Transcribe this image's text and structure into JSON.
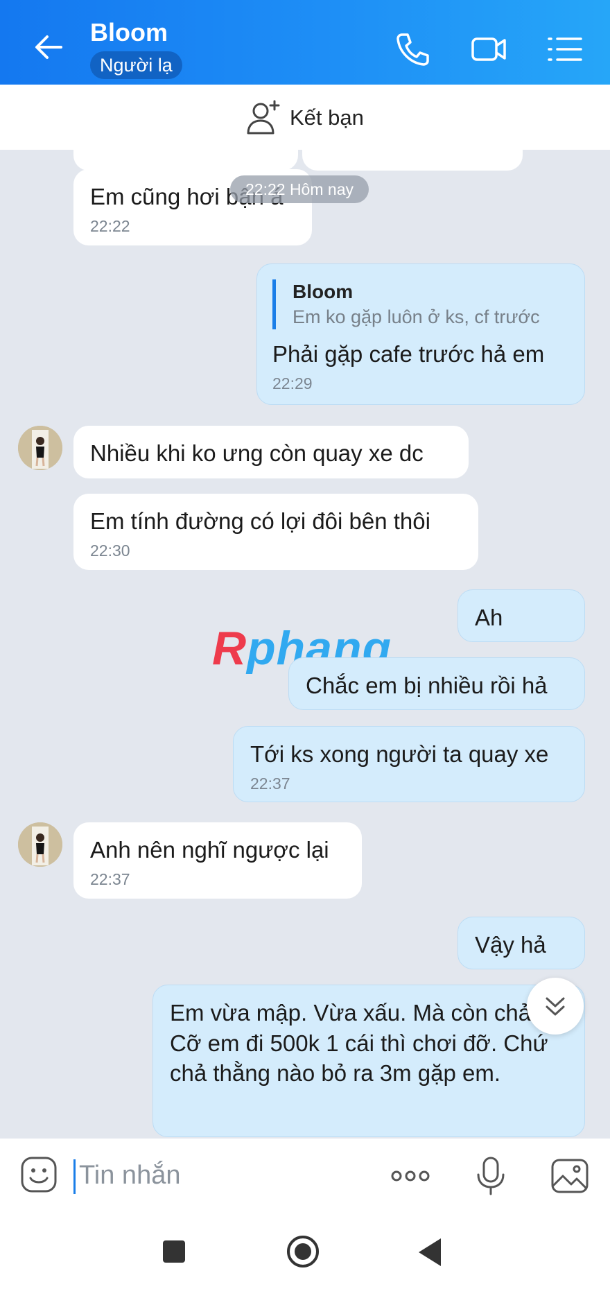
{
  "header": {
    "title": "Bloom",
    "subtitle": "Người lạ",
    "icons": [
      "back-arrow-icon",
      "phone-icon",
      "video-call-icon",
      "menu-list-icon"
    ]
  },
  "add_friend": {
    "label": "Kết bạn",
    "icon": "add-person-icon"
  },
  "chat": {
    "date_label": "22:22 Hôm nay",
    "messages": [
      {
        "side": "in",
        "text": "Em cũng hơi bận á",
        "time": "22:22"
      },
      {
        "side": "out",
        "quote_author": "Bloom",
        "quote_text": "Em ko gặp luôn ở ks, cf trước",
        "text": "Phải gặp cafe trước hả em",
        "time": "22:29"
      },
      {
        "side": "in",
        "text": "Nhiều khi ko ưng còn quay xe dc"
      },
      {
        "side": "in",
        "text": "Em tính đường có lợi đôi bên thôi",
        "time": "22:30"
      },
      {
        "side": "out",
        "text": "Ah"
      },
      {
        "side": "out",
        "text": "Chắc em bị nhiều rồi hả"
      },
      {
        "side": "out",
        "text": "Tới ks xong người ta quay xe",
        "time": "22:37"
      },
      {
        "side": "in",
        "text": "Anh nên nghĩ ngược lại",
        "time": "22:37"
      },
      {
        "side": "out",
        "text": "Vậy hả"
      },
      {
        "side": "out",
        "text": "Em vừa mập. Vừa xấu. Mà còn chảnh. Cỡ em đi 500k 1 cái thì chơi đỡ. Chứ chả thằng nào bỏ ra 3m gặp em."
      }
    ]
  },
  "watermark": {
    "part1": "R",
    "part2": "phang"
  },
  "input": {
    "placeholder": "Tin nhắn"
  },
  "colors": {
    "header_start": "#1478f0",
    "header_end": "#26a6f8",
    "outgoing_bubble": "#d4ecfc",
    "incoming_bubble": "#ffffff",
    "background": "#e3e7ee"
  }
}
